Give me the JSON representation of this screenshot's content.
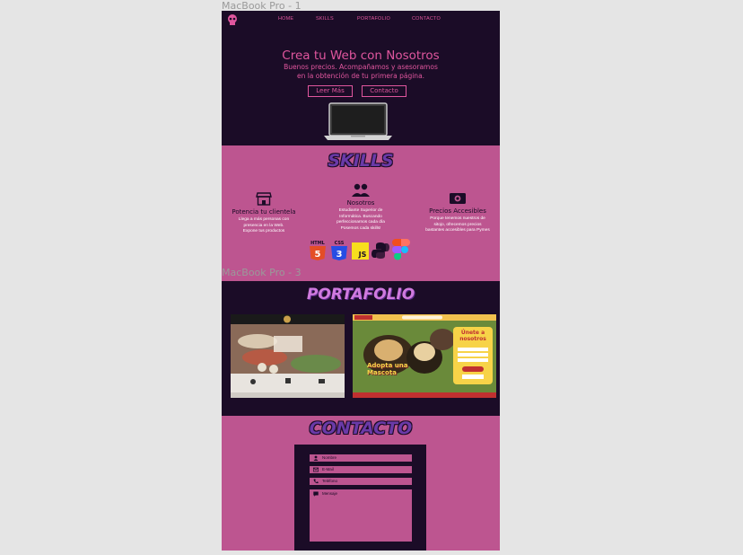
{
  "frames": {
    "frame1_label": "MacBook Pro - 1",
    "frame3_label": "MacBook Pro - 3"
  },
  "nav": {
    "items": [
      "HOME",
      "SKILLS",
      "PORTAFOLIO",
      "CONTACTO"
    ]
  },
  "hero": {
    "title": "Crea tu Web con Nosotros",
    "subtitle_line1": "Buenos precios. Acompañamos y asesoramos",
    "subtitle_line2": "en la obtención de tu primera página.",
    "btn_more": "Leer Más",
    "btn_contact": "Contacto"
  },
  "skills": {
    "heading": "SKILLS",
    "cols": [
      {
        "title": "Potencia tu clientela",
        "desc1": "Llega a más personas con",
        "desc2": "presencia en la Web.",
        "desc3": "Expone tus productos",
        "icon": "store-icon"
      },
      {
        "title": "Nosotros",
        "desc1": "Estudiante Superior de",
        "desc2": "Informática. Buscando",
        "desc3": "perfeccionarnos cada día",
        "desc4": "Posemos cada skills!",
        "icon": "users-icon"
      },
      {
        "title": "Precios Accesibles",
        "desc1": "Porque tenemos nuestros de",
        "desc2": "sitojo, ofrecemos precios",
        "desc3": "bastantes accesibles para Pymes",
        "icon": "money-icon"
      }
    ],
    "tech": [
      "HTML",
      "CSS",
      "JS",
      "Python",
      "Figma"
    ]
  },
  "portfolio": {
    "heading": "PORTAFOLIO",
    "card2_title_line1": "Adopta una",
    "card2_title_line2": "Mascota",
    "card2_side_title": "Únete a nosotros"
  },
  "contact": {
    "heading": "CONTACTO",
    "fields": {
      "name": "Nombre",
      "email": "E-Mail",
      "phone": "Teléfono",
      "message": "Mensaje"
    }
  },
  "colors": {
    "dark": "#1b0c27",
    "pink": "#bd5590",
    "accent": "#e0569e",
    "heading_purple": "#6a3aa8"
  }
}
